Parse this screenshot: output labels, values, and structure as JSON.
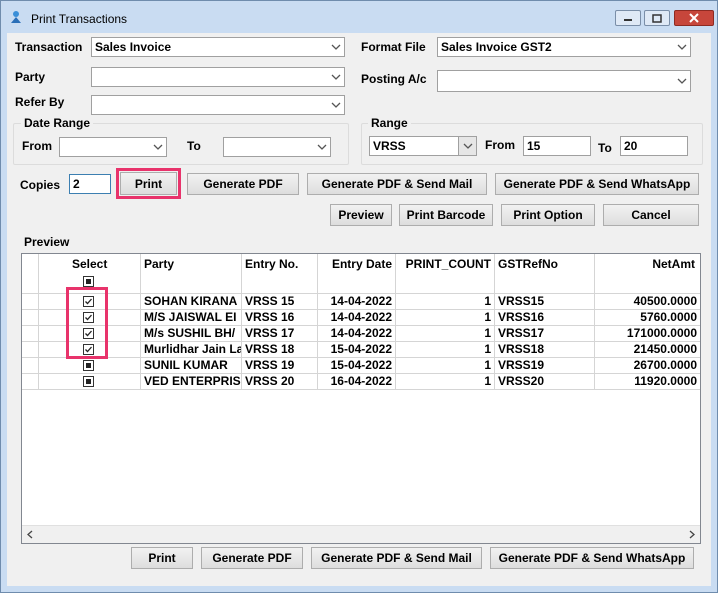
{
  "window": {
    "title": "Print Transactions"
  },
  "form": {
    "transaction_label": "Transaction",
    "transaction_value": "Sales Invoice",
    "format_file_label": "Format File",
    "format_file_value": "Sales Invoice GST2",
    "party_label": "Party",
    "party_value": "",
    "posting_label": "Posting A/c",
    "posting_value": "",
    "refer_by_label": "Refer By",
    "refer_by_value": ""
  },
  "date_range": {
    "title": "Date Range",
    "from_label": "From",
    "from_value": "",
    "to_label": "To",
    "to_value": ""
  },
  "range": {
    "title": "Range",
    "series_value": "VRSS",
    "from_label": "From",
    "from_value": "15",
    "to_label": "To",
    "to_value": "20"
  },
  "copies": {
    "label": "Copies",
    "value": "2"
  },
  "buttons": {
    "print": "Print",
    "generate_pdf": "Generate PDF",
    "generate_pdf_mail": "Generate PDF & Send Mail",
    "generate_pdf_whatsapp": "Generate PDF & Send WhatsApp",
    "preview": "Preview",
    "print_barcode": "Print Barcode",
    "print_option": "Print Option",
    "cancel": "Cancel"
  },
  "preview": {
    "title": "Preview",
    "columns": [
      "Select",
      "Party",
      "Entry No.",
      "Entry Date",
      "PRINT_COUNT",
      "GSTRefNo",
      "NetAmt"
    ],
    "rows": [
      {
        "checked": true,
        "party": "SOHAN KIRANA",
        "entry_no": "VRSS 15",
        "entry_date": "14-04-2022",
        "print_count": "1",
        "gst_ref": "VRSS15",
        "net_amt": "40500.0000"
      },
      {
        "checked": true,
        "party": "M/S JAISWAL EI",
        "entry_no": "VRSS 16",
        "entry_date": "14-04-2022",
        "print_count": "1",
        "gst_ref": "VRSS16",
        "net_amt": "5760.0000"
      },
      {
        "checked": true,
        "party": "M/s SUSHIL BH/",
        "entry_no": "VRSS 17",
        "entry_date": "14-04-2022",
        "print_count": "1",
        "gst_ref": "VRSS17",
        "net_amt": "171000.0000"
      },
      {
        "checked": true,
        "party": "Murlidhar Jain La",
        "entry_no": "VRSS 18",
        "entry_date": "15-04-2022",
        "print_count": "1",
        "gst_ref": "VRSS18",
        "net_amt": "21450.0000"
      },
      {
        "checked": false,
        "party": "SUNIL KUMAR",
        "entry_no": "VRSS 19",
        "entry_date": "15-04-2022",
        "print_count": "1",
        "gst_ref": "VRSS19",
        "net_amt": "26700.0000"
      },
      {
        "checked": false,
        "party": "VED ENTERPRIS",
        "entry_no": "VRSS 20",
        "entry_date": "16-04-2022",
        "print_count": "1",
        "gst_ref": "VRSS20",
        "net_amt": "11920.0000"
      }
    ]
  },
  "colors": {
    "highlight": "#e8336b",
    "title_bar": "#c9dcf2",
    "close_button": "#c7463b"
  }
}
